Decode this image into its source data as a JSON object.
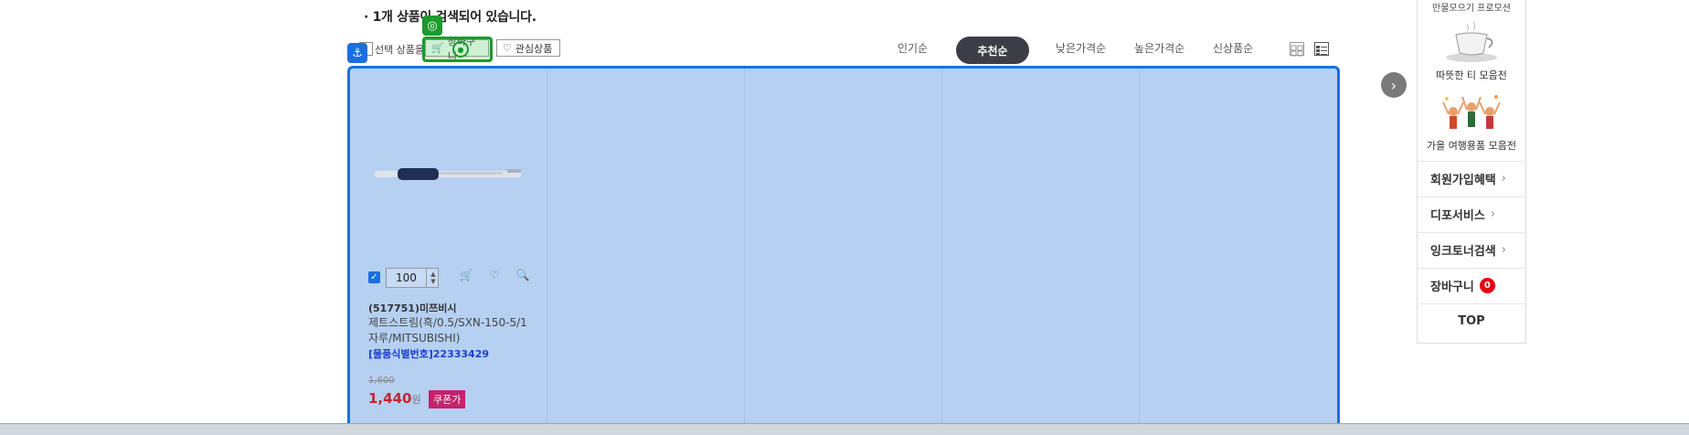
{
  "result_summary": "· 1개 상품이 검색되어 있습니다.",
  "toolbar": {
    "select_label": "선택 상품을",
    "cart_label": "장바구니",
    "wish_label": "관심상품"
  },
  "sort_options": [
    "인기순",
    "추천순",
    "낮은가격순",
    "높은가격순",
    "신상품순"
  ],
  "sort_active": "추천순",
  "product": {
    "qty": "100",
    "code": "(517751)미쯔비시",
    "name": "제트스트림(흑/0.5/SXN-150-5/1자루/MITSUBISHI)",
    "id_label": "[물품식별번호]22333429",
    "price_old": "1,600",
    "price_new": "1,440",
    "currency": "원",
    "coupon": "쿠폰가"
  },
  "sidebar": {
    "top_text": "만물모으기 프로모션",
    "banners": [
      {
        "caption": "따뜻한 티 모음전",
        "icon": "teacup-icon"
      },
      {
        "caption": "가을 여행용품 모음전",
        "icon": "travel-people-icon"
      }
    ],
    "links": [
      {
        "label": "회원가입혜택"
      },
      {
        "label": "디포서비스"
      },
      {
        "label": "잉크토너검색"
      }
    ],
    "cart_label": "장바구니",
    "cart_count": "0",
    "top_label": "TOP"
  },
  "colors": {
    "accent_blue": "#1a6fe0",
    "highlight_green": "#1b9a2d",
    "price_red": "#c0262e",
    "coupon_pink": "#c4236b",
    "sort_active_bg": "#3d3d45"
  }
}
